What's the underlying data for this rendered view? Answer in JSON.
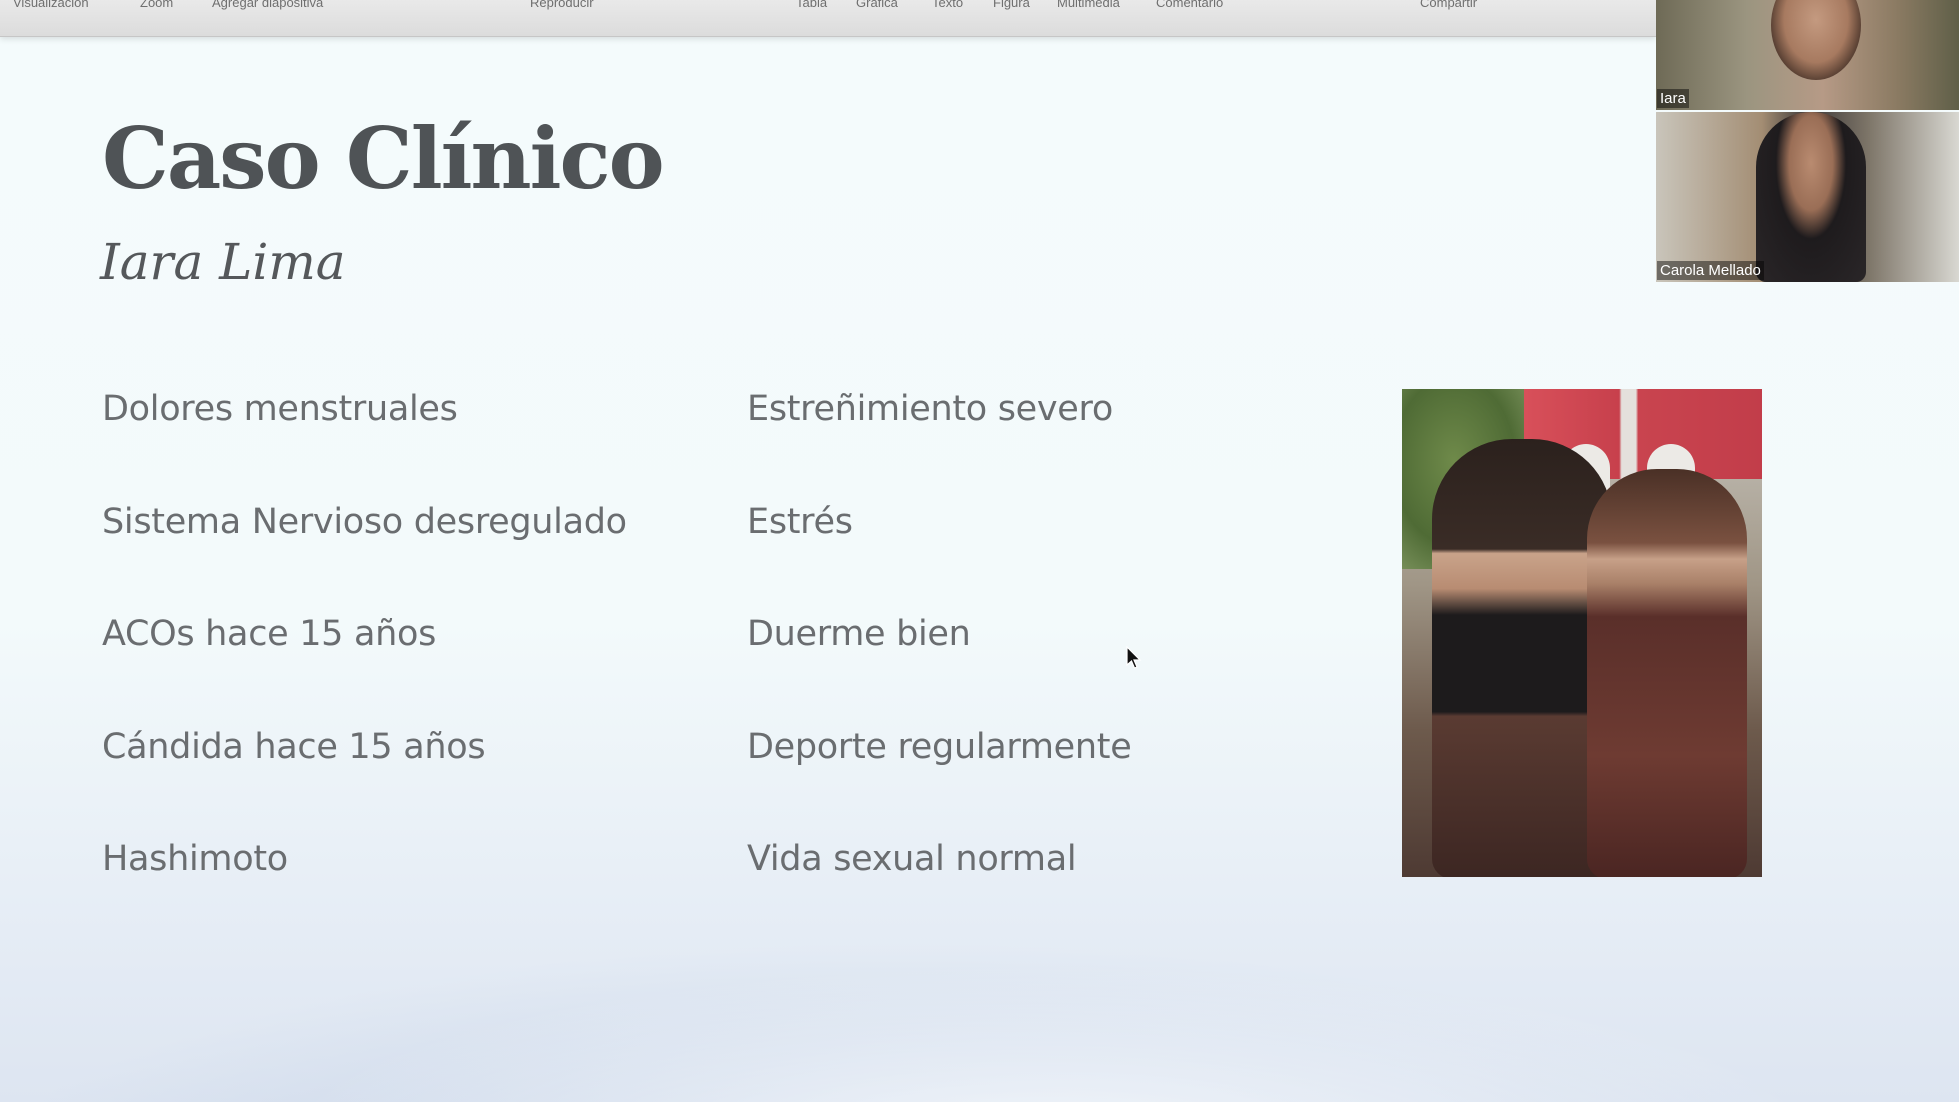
{
  "toolbar": {
    "items": [
      "Visualización",
      "Zoom",
      "Agregar diapositiva",
      "Reproducir",
      "Tabla",
      "Gráfica",
      "Texto",
      "Figura",
      "Multimedia",
      "Comentario",
      "Compartir"
    ]
  },
  "slide": {
    "title": "Caso Clínico",
    "subtitle": "Iara Lima",
    "left_column": [
      "Dolores menstruales",
      "Sistema Nervioso desregulado",
      "ACOs hace 15 años",
      "Cándida hace 15 años",
      "Hashimoto"
    ],
    "right_column": [
      "Estreñimiento severo",
      "Estrés",
      "Duerme bien",
      "Deporte regularmente",
      "Vida sexual normal"
    ]
  },
  "video_call": {
    "participants": [
      {
        "name": "Iara"
      },
      {
        "name": "Carola Mellado"
      }
    ]
  },
  "icons": {
    "cursor": "mouse-pointer-icon"
  }
}
